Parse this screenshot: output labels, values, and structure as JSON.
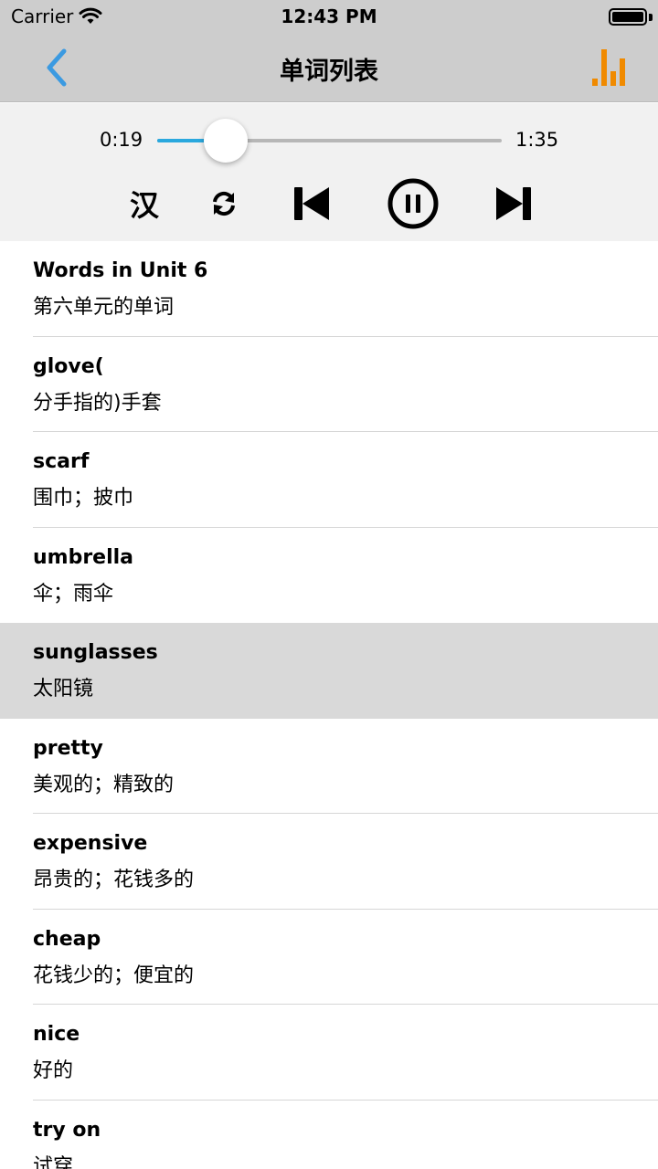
{
  "status_bar": {
    "carrier": "Carrier",
    "time": "12:43 PM"
  },
  "nav": {
    "title": "单词列表",
    "back_icon": "chevron-left-icon",
    "right_icon": "equalizer-icon",
    "accent_color": "#3b9ae1",
    "right_icon_color": "#f08a00"
  },
  "player": {
    "current_time": "0:19",
    "total_time": "1:35",
    "progress_fraction": 0.2,
    "progress_color": "#2aa8de",
    "translate_toggle_label": "汉",
    "controls": [
      "translate-toggle",
      "repeat-icon",
      "previous-track-icon",
      "pause-icon",
      "next-track-icon"
    ]
  },
  "words": [
    {
      "en": "Words in Unit 6",
      "cn": "第六单元的单词",
      "selected": false
    },
    {
      "en": "glove(",
      "cn": "分手指的)手套",
      "selected": false
    },
    {
      "en": "scarf",
      "cn": "围巾；披巾",
      "selected": false
    },
    {
      "en": "umbrella",
      "cn": "伞；雨伞",
      "selected": false
    },
    {
      "en": "sunglasses",
      "cn": "太阳镜",
      "selected": true
    },
    {
      "en": "pretty",
      "cn": "美观的；精致的",
      "selected": false
    },
    {
      "en": "expensive",
      "cn": "昂贵的；花钱多的",
      "selected": false
    },
    {
      "en": "cheap",
      "cn": "花钱少的；便宜的",
      "selected": false
    },
    {
      "en": "nice",
      "cn": "好的",
      "selected": false
    },
    {
      "en": "try on",
      "cn": "试穿",
      "selected": false
    }
  ]
}
